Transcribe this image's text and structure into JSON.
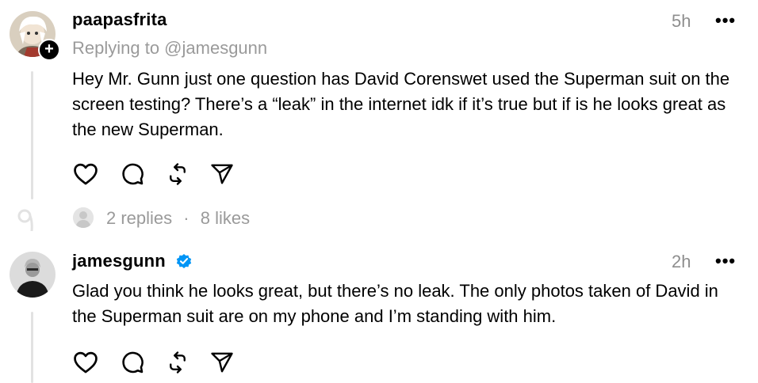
{
  "post1": {
    "username": "paapasfrita",
    "time": "5h",
    "more": "•••",
    "replying_to": "Replying to @jamesgunn",
    "text": "Hey Mr. Gunn just one question has David Corenswet used the Superman suit on the screen testing? There’s a “leak” in the internet idk if it’s true but if is he looks great as the new Superman.",
    "follow_badge": "+"
  },
  "thread_meta": {
    "replies": "2 replies",
    "separator": "·",
    "likes": "8 likes"
  },
  "post2": {
    "username": "jamesgunn",
    "time": "2h",
    "more": "•••",
    "text": "Glad you think he looks great, but there’s no leak. The only photos taken of David in the Superman suit are on my phone and I’m standing with him."
  },
  "colors": {
    "verified": "#0095f6",
    "secondary_text": "#9a9a9a",
    "thread_line": "#e2e2e2"
  },
  "icons": [
    "heart-icon",
    "comment-icon",
    "repost-icon",
    "share-icon",
    "verified-badge-icon"
  ]
}
